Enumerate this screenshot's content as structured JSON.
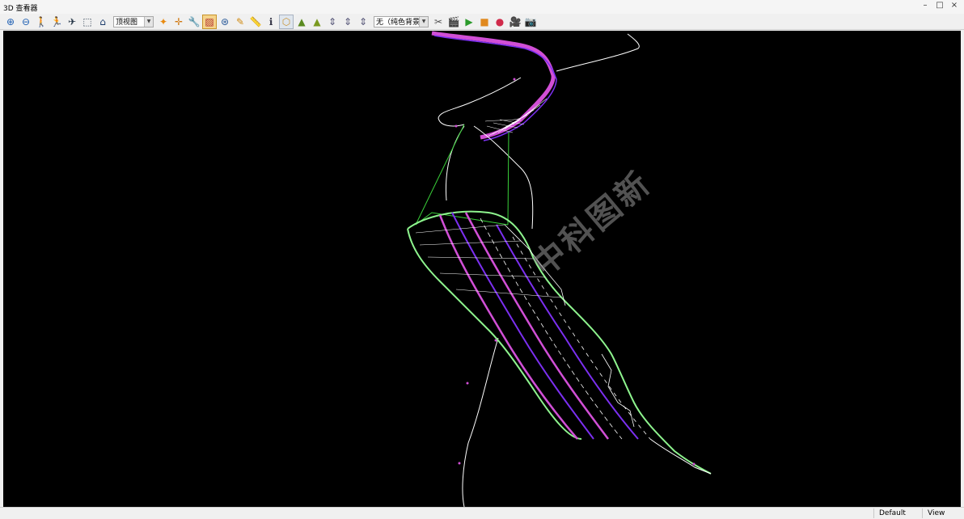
{
  "window": {
    "title": "3D 查看器",
    "minimize": "–",
    "maximize": "□",
    "close": "×"
  },
  "toolbar": {
    "view_select": "顶视图",
    "background_select": "无（纯色背景）",
    "icons": {
      "zoom_in": "⊕",
      "zoom_out": "⊖",
      "walk": "🚶",
      "walk2": "🏃",
      "fly": "✈",
      "box": "⬚",
      "home": "⌂",
      "orbit_center": "✦",
      "crosshair": "✛",
      "wrench": "🔧",
      "draw_toggle": "▨",
      "orbit": "⊛",
      "pencil": "✎",
      "ruler": "📏",
      "info": "ℹ",
      "select": "⬡",
      "terrain1": "▲",
      "terrain2": "▲",
      "elev1": "⇕",
      "elev2": "⇕",
      "elev3": "⇕",
      "tools": "✂",
      "clapper": "🎬",
      "play": "▶",
      "stop": "■",
      "record": "●",
      "camera_video": "🎥",
      "camera": "📷"
    }
  },
  "viewport": {
    "background": "#000000",
    "watermark": "中科图新"
  },
  "statusbar": {
    "mode": "Default",
    "state": "View"
  },
  "colors": {
    "road_magenta": "#d14fd6",
    "road_purple": "#7b2ff0",
    "edge_green": "#8ef48e",
    "line_white": "#ffffff",
    "line_green": "#3ad13a"
  }
}
